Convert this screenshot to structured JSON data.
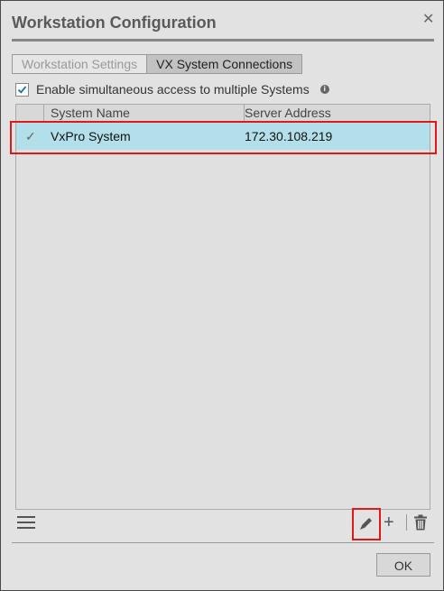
{
  "window": {
    "title": "Workstation Configuration"
  },
  "tabs": [
    {
      "label": "Workstation Settings",
      "active": false
    },
    {
      "label": "VX System Connections",
      "active": true
    }
  ],
  "option": {
    "label": "Enable simultaneous access to multiple Systems",
    "checked": true,
    "check_glyph": "✓",
    "info_glyph": "i"
  },
  "table": {
    "columns": [
      "System Name",
      "Server Address"
    ],
    "rows": [
      {
        "checked": true,
        "check_glyph": "✓",
        "name": "VxPro System",
        "address": "172.30.108.219"
      }
    ]
  },
  "toolbar": {
    "menu_icon": "menu-icon",
    "edit_icon": "edit-icon",
    "add_glyph": "+",
    "delete_icon": "trash-icon"
  },
  "close_glyph": "✕",
  "ok_label": "OK",
  "colors": {
    "dialog_bg": "#e2e2e2",
    "selected_row": "#b2dfe9",
    "highlight_border": "#e01818",
    "active_tab": "#c2c2c2"
  }
}
